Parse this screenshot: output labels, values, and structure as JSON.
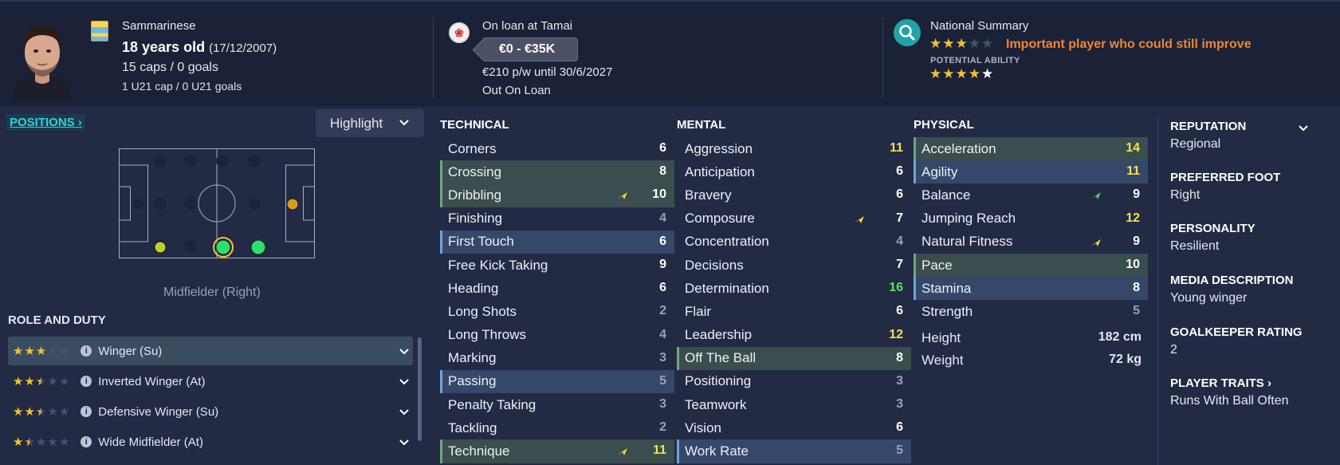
{
  "header": {
    "nationality": "Sammarinese",
    "age": "18 years old",
    "dob": "(17/12/2007)",
    "caps": "15 caps / 0 goals",
    "u21_caps": "1 U21 cap / 0 U21 goals",
    "loan_status": "On loan at Tamai",
    "value": "€0 - €35K",
    "wage": "€210 p/w until 30/6/2027",
    "status": "Out On Loan",
    "summary_title": "National Summary",
    "current_ability_stars": 3,
    "summary_text": "Important player who could still improve",
    "potential_label": "POTENTIAL ABILITY",
    "potential_ability_stars": 4.5,
    "icons": [
      "flag-icon",
      "club-badge-icon",
      "search-icon"
    ]
  },
  "left": {
    "positions_label": "POSITIONS",
    "highlight_label": "Highlight",
    "position_name": "Midfielder (Right)",
    "role_title": "ROLE AND DUTY",
    "roles": [
      {
        "stars": 3,
        "name": "Winger (Su)",
        "selected": true
      },
      {
        "stars": 2.5,
        "name": "Inverted Winger (At)",
        "selected": false
      },
      {
        "stars": 2.5,
        "name": "Defensive Winger (Su)",
        "selected": false
      },
      {
        "stars": 1.5,
        "name": "Wide Midfielder (At)",
        "selected": false
      }
    ]
  },
  "technical": {
    "title": "TECHNICAL",
    "rows": [
      {
        "name": "Corners",
        "value": "6",
        "color": "#ffffff"
      },
      {
        "name": "Crossing",
        "value": "8",
        "color": "#ffffff",
        "highlight": "green"
      },
      {
        "name": "Dribbling",
        "value": "10",
        "color": "#ffffff",
        "highlight": "green",
        "trend": "up-yellow"
      },
      {
        "name": "Finishing",
        "value": "4",
        "color": "#9ba1b3"
      },
      {
        "name": "First Touch",
        "value": "6",
        "color": "#ffffff",
        "highlight": "blue"
      },
      {
        "name": "Free Kick Taking",
        "value": "9",
        "color": "#ffffff"
      },
      {
        "name": "Heading",
        "value": "6",
        "color": "#ffffff"
      },
      {
        "name": "Long Shots",
        "value": "2",
        "color": "#9ba1b3"
      },
      {
        "name": "Long Throws",
        "value": "4",
        "color": "#9ba1b3"
      },
      {
        "name": "Marking",
        "value": "3",
        "color": "#9ba1b3"
      },
      {
        "name": "Passing",
        "value": "5",
        "color": "#9ba1b3",
        "highlight": "blue"
      },
      {
        "name": "Penalty Taking",
        "value": "3",
        "color": "#9ba1b3"
      },
      {
        "name": "Tackling",
        "value": "2",
        "color": "#9ba1b3"
      },
      {
        "name": "Technique",
        "value": "11",
        "color": "#f4e24a",
        "highlight": "green",
        "trend": "up-yellow"
      }
    ]
  },
  "mental": {
    "title": "MENTAL",
    "rows": [
      {
        "name": "Aggression",
        "value": "11",
        "color": "#f4e24a"
      },
      {
        "name": "Anticipation",
        "value": "6",
        "color": "#ffffff"
      },
      {
        "name": "Bravery",
        "value": "6",
        "color": "#ffffff"
      },
      {
        "name": "Composure",
        "value": "7",
        "color": "#ffffff",
        "trend": "up-yellow"
      },
      {
        "name": "Concentration",
        "value": "4",
        "color": "#9ba1b3"
      },
      {
        "name": "Decisions",
        "value": "7",
        "color": "#ffffff"
      },
      {
        "name": "Determination",
        "value": "16",
        "color": "#57e35d"
      },
      {
        "name": "Flair",
        "value": "6",
        "color": "#ffffff"
      },
      {
        "name": "Leadership",
        "value": "12",
        "color": "#f4e24a"
      },
      {
        "name": "Off The Ball",
        "value": "8",
        "color": "#ffffff",
        "highlight": "green"
      },
      {
        "name": "Positioning",
        "value": "3",
        "color": "#9ba1b3"
      },
      {
        "name": "Teamwork",
        "value": "3",
        "color": "#9ba1b3"
      },
      {
        "name": "Vision",
        "value": "6",
        "color": "#ffffff"
      },
      {
        "name": "Work Rate",
        "value": "5",
        "color": "#9ba1b3",
        "highlight": "blue"
      }
    ]
  },
  "physical": {
    "title": "PHYSICAL",
    "rows": [
      {
        "name": "Acceleration",
        "value": "14",
        "color": "#f4e24a",
        "highlight": "green"
      },
      {
        "name": "Agility",
        "value": "11",
        "color": "#f4e24a",
        "highlight": "blue"
      },
      {
        "name": "Balance",
        "value": "9",
        "color": "#ffffff",
        "trend": "up-green"
      },
      {
        "name": "Jumping Reach",
        "value": "12",
        "color": "#f4e24a"
      },
      {
        "name": "Natural Fitness",
        "value": "9",
        "color": "#ffffff",
        "trend": "up-yellow"
      },
      {
        "name": "Pace",
        "value": "10",
        "color": "#ffffff",
        "highlight": "green"
      },
      {
        "name": "Stamina",
        "value": "8",
        "color": "#ffffff",
        "highlight": "blue"
      },
      {
        "name": "Strength",
        "value": "5",
        "color": "#9ba1b3"
      }
    ],
    "height_label": "Height",
    "height_value": "182 cm",
    "weight_label": "Weight",
    "weight_value": "72 kg"
  },
  "info": {
    "reputation_label": "REPUTATION",
    "reputation": "Regional",
    "foot_label": "PREFERRED FOOT",
    "foot": "Right",
    "personality_label": "PERSONALITY",
    "personality": "Resilient",
    "media_label": "MEDIA DESCRIPTION",
    "media": "Young winger",
    "gk_label": "GOALKEEPER RATING",
    "gk": "2",
    "traits_label": "PLAYER TRAITS",
    "traits": "Runs With Ball Often"
  }
}
